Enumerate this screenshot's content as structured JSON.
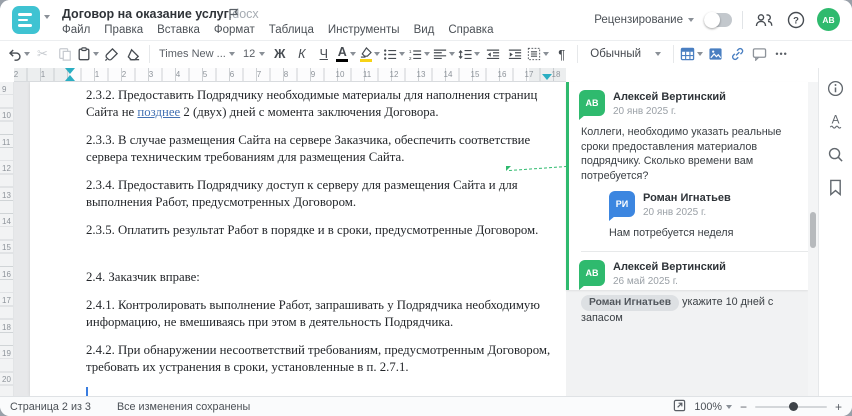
{
  "header": {
    "title": "Договор на оказание услуг",
    "title_ext": ".docx",
    "menu": [
      "Файл",
      "Правка",
      "Вставка",
      "Формат",
      "Таблица",
      "Инструменты",
      "Вид",
      "Справка"
    ],
    "review_label": "Рецензирование",
    "review_toggle_state": "off",
    "avatar_initials": "АВ",
    "help_glyph": "?"
  },
  "toolbar": {
    "font_name": "Times New ...",
    "font_size": "12",
    "bold_label": "Ж",
    "italic_label": "К",
    "underline_label": "Ч",
    "font_color_label": "А",
    "pilcrow": "¶",
    "more_glyph": "•••",
    "style_name": "Обычный",
    "scissors_glyph": "✂"
  },
  "ruler": {
    "h_neg": [
      "2",
      "1"
    ],
    "h_pos": [
      "1",
      "2",
      "3",
      "4",
      "5",
      "6",
      "7",
      "8",
      "9",
      "10",
      "11",
      "12",
      "13",
      "14",
      "15",
      "16",
      "17",
      "18"
    ],
    "v": [
      "9",
      "10",
      "11",
      "12",
      "13",
      "14",
      "15",
      "16",
      "17",
      "18",
      "19",
      "20"
    ]
  },
  "document": {
    "p1_before": "2.3.2. Предоставить Подрядчику необходимые материалы для наполнения страниц Сайта не ",
    "p1_link": "позднее",
    "p1_after": " 2 (двух) дней с момента заключения Договора.",
    "p2": "2.3.3. В случае размещения Сайта на сервере Заказчика, обеспечить соответствие сервера техническим требованиям для размещения Сайта.",
    "p3": "2.3.4. Предоставить Подрядчику доступ к серверу для размещения Сайта и для выполнения Работ, предусмотренных Договором.",
    "p4": "2.3.5. Оплатить результат Работ в порядке и в сроки, предусмотренные Договором.",
    "p5": "2.4. Заказчик вправе:",
    "p6": "2.4.1. Контролировать выполнение Работ, запрашивать у Подрядчика необходимую информацию, не вмешиваясь при этом в деятельность Подрядчика.",
    "p7": "2.4.2. При обнаружении несоответствий требованиям, предусмотренным Договором, требовать их устранения в сроки, установленные в п. 2.7.1."
  },
  "comments": {
    "c1": {
      "initials": "АВ",
      "name": "Алексей Вертинский",
      "date": "20 янв 2025 г.",
      "text": "Коллеги, необходимо указать реальные сроки предоставления материалов подрядчику. Сколько времени вам потребуется?"
    },
    "c2": {
      "initials": "РИ",
      "name": "Роман Игнатьев",
      "date": "20 янв 2025 г.",
      "text": "Нам потребуется неделя"
    },
    "c3": {
      "initials": "АВ",
      "name": "Алексей Вертинский",
      "date": "26 май 2025 г.",
      "mention": "Роман Игнатьев",
      "text": " укажите 10 дней с запасом"
    }
  },
  "statusbar": {
    "page_info": "Страница 2 из 3",
    "saved_info": "Все изменения сохранены",
    "zoom_value": "100%",
    "minus": "−",
    "plus": "+"
  },
  "colors": {
    "brand_teal": "#3fc3d2",
    "comment_green": "#2fba6e",
    "reply_blue": "#3c86e0",
    "indent_marker_teal": "#2aaec2",
    "highlight_yellow": "#f7d316",
    "font_color_bar": "#000000",
    "cursor_blue": "#3a7de0"
  }
}
